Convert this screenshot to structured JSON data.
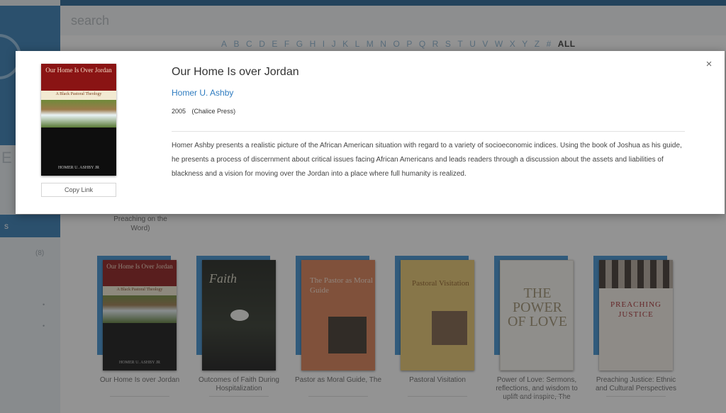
{
  "search": {
    "placeholder": "search"
  },
  "alphabet": [
    "A",
    "B",
    "C",
    "D",
    "E",
    "F",
    "G",
    "H",
    "I",
    "J",
    "K",
    "L",
    "M",
    "N",
    "O",
    "P",
    "Q",
    "R",
    "S",
    "T",
    "U",
    "V",
    "W",
    "X",
    "Y",
    "Z",
    "#"
  ],
  "alphabet_all": "ALL",
  "sidebar": {
    "letter": "E",
    "active_label": "s",
    "count": "(8)"
  },
  "stub_caption": "Preaching on the Word)",
  "books": [
    {
      "caption": "Our Home Is over Jordan",
      "cover_title": "Our Home Is Over Jordan",
      "cover_subtitle": "A Black Pastoral Theology",
      "cover_author": "HOMER U. ASHBY JR"
    },
    {
      "caption": "Outcomes of Faith During Hospitalization",
      "cover_title": "Faith"
    },
    {
      "caption": "Pastor as Moral Guide, The",
      "cover_title": "The Pastor as Moral Guide"
    },
    {
      "caption": "Pastoral Visitation",
      "cover_title": "Pastoral Visitation"
    },
    {
      "caption": "Power of Love: Sermons, reflections, and wisdom to uplift and inspire, The",
      "cover_title": "THE POWER OF LOVE"
    },
    {
      "caption": "Preaching Justice: Ethnic and Cultural Perspectives",
      "cover_title": "PREACHING JUSTICE"
    }
  ],
  "modal": {
    "cover_title": "Our Home Is Over Jordan",
    "cover_subtitle": "A Black Pastoral Theology",
    "cover_author": "HOMER U. ASHBY JR",
    "copy_link": "Copy Link",
    "title": "Our Home Is over Jordan",
    "author": "Homer U. Ashby",
    "year": "2005",
    "publisher": "(Chalice Press)",
    "description": "Homer Ashby presents a realistic picture of the African American situation with regard to a variety of socioeconomic indices. Using the book of Joshua as his guide, he presents a process of discernment about critical issues facing African Americans and leads readers through a discussion about the assets and liabilities of blackness and a vision for moving over the Jordan into a place where full humanity is realized.",
    "close": "×"
  },
  "colors": {
    "accent": "#2e79b3",
    "link": "#2f7cc0",
    "overlay": "rgba(40,40,40,0.5)"
  }
}
